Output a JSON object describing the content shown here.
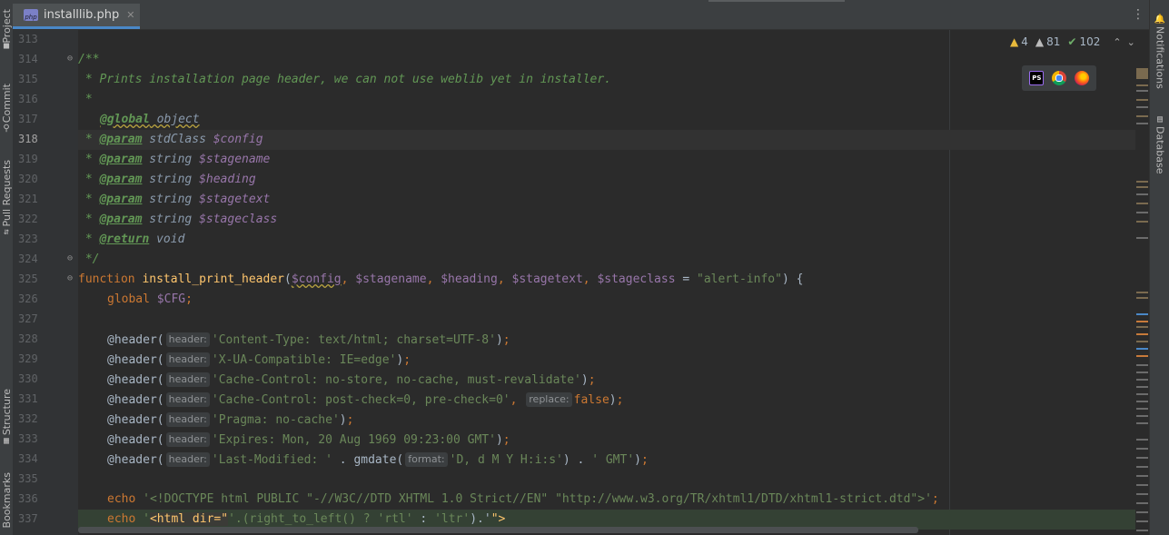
{
  "left_toolbar": {
    "tabs": [
      {
        "label": "Project",
        "icon": "folder-icon",
        "glyph": "▀"
      },
      {
        "label": "Commit",
        "icon": "commit-icon",
        "glyph": "⚲"
      },
      {
        "label": "Pull Requests",
        "icon": "pull-request-icon",
        "glyph": "⇵"
      },
      {
        "label": "Structure",
        "icon": "structure-icon",
        "glyph": "▦"
      },
      {
        "label": "Bookmarks",
        "icon": "bookmark-icon",
        "glyph": ""
      }
    ]
  },
  "right_toolbar": {
    "tabs": [
      {
        "label": "Notifications",
        "icon": "bell-icon",
        "glyph": "🔔"
      },
      {
        "label": "Database",
        "icon": "database-icon",
        "glyph": "▤"
      }
    ]
  },
  "editor_tab": {
    "filename": "installlib.php",
    "icon_text": "php",
    "close_glyph": "✕",
    "more_glyph": "⋮"
  },
  "inspections": {
    "warnings_glyph": "▲",
    "warnings": "4",
    "weak_warnings_glyph": "▲",
    "weak_warnings": "81",
    "typos_glyph": "✔",
    "typos": "102",
    "prev_glyph": "⌃",
    "next_glyph": "⌄"
  },
  "browser_popup": {
    "phpstorm_label": "PS"
  },
  "editor": {
    "current_line": 318,
    "lines": [
      {
        "n": "313"
      },
      {
        "n": "314",
        "fold": "⊖"
      },
      {
        "n": "315"
      },
      {
        "n": "316"
      },
      {
        "n": "317",
        "bulb": "💡"
      },
      {
        "n": "318"
      },
      {
        "n": "319"
      },
      {
        "n": "320"
      },
      {
        "n": "321"
      },
      {
        "n": "322"
      },
      {
        "n": "323"
      },
      {
        "n": "324",
        "fold": "⊖"
      },
      {
        "n": "325",
        "fold": "⊖"
      },
      {
        "n": "326"
      },
      {
        "n": "327"
      },
      {
        "n": "328"
      },
      {
        "n": "329"
      },
      {
        "n": "330"
      },
      {
        "n": "331"
      },
      {
        "n": "332"
      },
      {
        "n": "333"
      },
      {
        "n": "334"
      },
      {
        "n": "335"
      },
      {
        "n": "336"
      },
      {
        "n": "337"
      }
    ],
    "code": {
      "l314": "/**",
      "l315": " * Prints installation page header, we can not use weblib yet in installer.",
      "l316": " *",
      "l317_tag": "@global",
      "l317_rest": " object",
      "l318_tag": "@param",
      "l318_type": " stdClass ",
      "l318_var": "$config",
      "l319_tag": "@param",
      "l319_type": " string ",
      "l319_var": "$stagename",
      "l320_tag": "@param",
      "l320_type": " string ",
      "l320_var": "$heading",
      "l321_tag": "@param",
      "l321_type": " string ",
      "l321_var": "$stagetext",
      "l322_tag": "@param",
      "l322_type": " string ",
      "l322_var": "$stageclass",
      "l323_tag": "@return",
      "l323_type": " void",
      "l324": " */",
      "doc_star": " * ",
      "l325_kw": "function ",
      "l325_fn": "install_print_header",
      "l325_p1": "$config",
      "l325_p2": "$stagename",
      "l325_p3": "$heading",
      "l325_p4": "$stagetext",
      "l325_p5": "$stageclass",
      "l325_default": "\"alert-info\"",
      "l326_kw": "global ",
      "l326_var": "$CFG",
      "header_call": "@header(",
      "hint_header": "header:",
      "hint_replace": "replace:",
      "hint_format": "format:",
      "l328_str": "'Content-Type: text/html; charset=UTF-8'",
      "l329_str": "'X-UA-Compatible: IE=edge'",
      "l330_str": "'Cache-Control: no-store, no-cache, must-revalidate'",
      "l331_str": "'Cache-Control: post-check=0, pre-check=0'",
      "l331_false": "false",
      "l332_str": "'Pragma: no-cache'",
      "l333_str": "'Expires: Mon, 20 Aug 1969 09:23:00 GMT'",
      "l334_str1": "'Last-Modified: '",
      "l334_fn": "gmdate(",
      "l334_str2": "'D, d M Y H:i:s'",
      "l334_str3": "' GMT'",
      "l336_kw": "echo ",
      "l336_str": "'<!DOCTYPE html PUBLIC \"-//W3C//DTD XHTML 1.0 Strict//EN\" \"http://www.w3.org/TR/xhtml1/DTD/xhtml1-strict.dtd\">'",
      "l337_kw": "echo ",
      "l337_q": "'",
      "l337_html": "<html dir=\"",
      "l337_mid": "'.(right_to_left() ? ",
      "l337_rtl": "'rtl'",
      "l337_colon": " : ",
      "l337_ltr": "'ltr'",
      "l337_end1": ").'",
      "l337_end2": "\">"
    }
  },
  "colors": {
    "comment": "#629755",
    "keyword": "#cc7832",
    "function": "#ffc66d",
    "variable": "#9876aa",
    "string": "#6a8759",
    "default": "#a9b7c6",
    "background": "#2b2b2b"
  }
}
